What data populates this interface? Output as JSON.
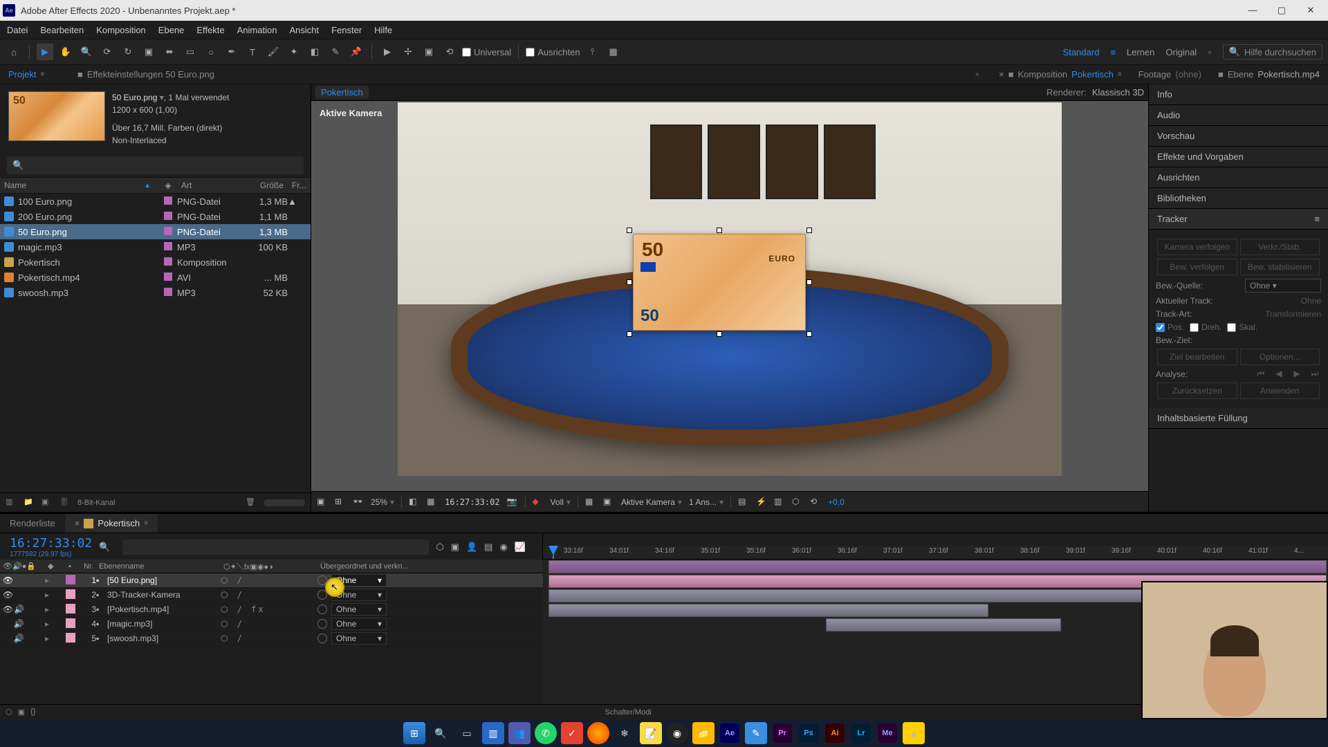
{
  "title": "Adobe After Effects 2020 - Unbenanntes Projekt.aep *",
  "menu": [
    "Datei",
    "Bearbeiten",
    "Komposition",
    "Ebene",
    "Effekte",
    "Animation",
    "Ansicht",
    "Fenster",
    "Hilfe"
  ],
  "toolbar": {
    "universal": "Universal",
    "align": "Ausrichten",
    "workspaces": {
      "standard": "Standard",
      "learn": "Lernen",
      "original": "Original"
    },
    "search_placeholder": "Hilfe durchsuchen"
  },
  "panelTabs": {
    "project": "Projekt",
    "effectControls": "Effekteinstellungen 50 Euro.png",
    "composition": "Komposition",
    "compositionName": "Pokertisch",
    "footage": "Footage",
    "footageNone": "(ohne)",
    "layer": "Ebene",
    "layerName": "Pokertisch.mp4"
  },
  "projectInfo": {
    "name": "50 Euro.png",
    "used": ", 1 Mal verwendet",
    "dim": "1200 x 600 (1,00)",
    "colors": "Über 16,7 Mill. Farben (direkt)",
    "interlace": "Non-Interlaced"
  },
  "projectCols": {
    "name": "Name",
    "type": "Art",
    "size": "Größe",
    "fr": "Fr..."
  },
  "projectItems": [
    {
      "name": "100 Euro.png",
      "type": "PNG-Datei",
      "size": "1,3 MB",
      "fr": "▲",
      "ico": "img"
    },
    {
      "name": "200 Euro.png",
      "type": "PNG-Datei",
      "size": "1,1 MB",
      "fr": "",
      "ico": "img"
    },
    {
      "name": "50 Euro.png",
      "type": "PNG-Datei",
      "size": "1,3 MB",
      "fr": "",
      "ico": "img",
      "sel": true
    },
    {
      "name": "magic.mp3",
      "type": "MP3",
      "size": "100 KB",
      "fr": "",
      "ico": "audio"
    },
    {
      "name": "Pokertisch",
      "type": "Komposition",
      "size": "",
      "fr": "",
      "ico": "comp"
    },
    {
      "name": "Pokertisch.mp4",
      "type": "AVI",
      "size": "... MB",
      "fr": "",
      "ico": "vid"
    },
    {
      "name": "swoosh.mp3",
      "type": "MP3",
      "size": "52 KB",
      "fr": "",
      "ico": "audio"
    }
  ],
  "projectFooter": {
    "bpc": "8-Bit-Kanal"
  },
  "compNav": {
    "crumb": "Pokertisch",
    "renderer": "Renderer:",
    "rendererValue": "Klassisch 3D"
  },
  "activeCamera": "Aktive Kamera",
  "banknote": {
    "fifty": "50",
    "fifty2": "50",
    "euro": "EURO"
  },
  "viewerFooter": {
    "zoom": "25%",
    "tc": "16:27:33:02",
    "res": "Voll",
    "camera": "Aktive Kamera",
    "views": "1 Ans...",
    "exposure": "+0,0"
  },
  "rightPanels": {
    "info": "Info",
    "audio": "Audio",
    "preview": "Vorschau",
    "effects": "Effekte und Vorgaben",
    "align": "Ausrichten",
    "libraries": "Bibliotheken",
    "tracker": "Tracker",
    "contentFill": "Inhaltsbasierte Füllung"
  },
  "tracker": {
    "trackCamera": "Kamera verfolgen",
    "warpStab": "Verkr./Stab.",
    "trackMotion": "Bew. verfolgen",
    "stabilize": "Bew. stabilisieren",
    "sourceLabel": "Bew.-Quelle:",
    "sourceValue": "Ohne",
    "currentLabel": "Aktueller Track:",
    "currentValue": "Ohne",
    "typeLabel": "Track-Art:",
    "typeValue": "Transformieren",
    "pos": "Pos.",
    "rot": "Dreh.",
    "scale": "Skal.",
    "targetLabel": "Bew.-Ziel:",
    "editTarget": "Ziel bearbeiten",
    "options": "Optionen...",
    "analyze": "Analyse:",
    "reset": "Zurücksetzen",
    "apply": "Anwenden"
  },
  "timeline": {
    "tabs": {
      "renderQueue": "Renderliste",
      "comp": "Pokertisch"
    },
    "timecode": "16:27:33:02",
    "subtc": "1777592 (29,97 fps)",
    "cols": {
      "num": "Nr.",
      "name": "Ebenenname",
      "parent": "Übergeordnet und verkn..."
    },
    "ticks": [
      "33:16f",
      "34:01f",
      "34:16f",
      "35:01f",
      "35:16f",
      "36:01f",
      "36:16f",
      "37:01f",
      "37:16f",
      "38:01f",
      "38:16f",
      "39:01f",
      "39:16f",
      "40:01f",
      "40:16f",
      "41:01f",
      "4..."
    ],
    "layers": [
      {
        "num": "1",
        "name": "[50 Euro.png]",
        "parent": "Ohne",
        "sel": true,
        "eye": true,
        "sound": false
      },
      {
        "num": "2",
        "name": "3D-Tracker-Kamera",
        "parent": "Ohne",
        "sel": false,
        "eye": true,
        "sound": false
      },
      {
        "num": "3",
        "name": "[Pokertisch.mp4]",
        "parent": "Ohne",
        "sel": false,
        "eye": true,
        "sound": true
      },
      {
        "num": "4",
        "name": "[magic.mp3]",
        "parent": "Ohne",
        "sel": false,
        "eye": false,
        "sound": true
      },
      {
        "num": "5",
        "name": "[swoosh.mp3]",
        "parent": "Ohne",
        "sel": false,
        "eye": false,
        "sound": true
      }
    ],
    "footer": {
      "mode": "Schalter/Modi"
    }
  }
}
